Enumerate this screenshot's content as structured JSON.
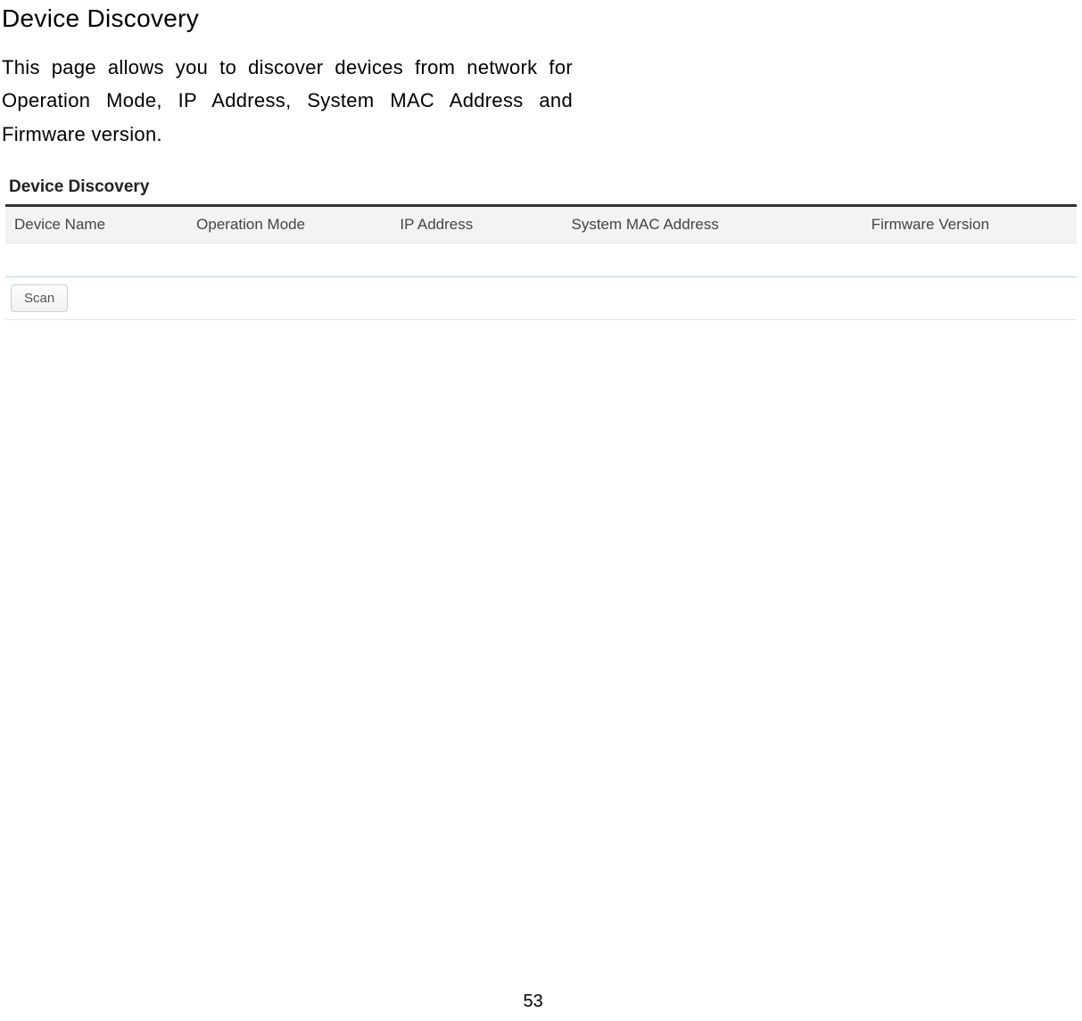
{
  "page": {
    "title": "Device Discovery",
    "description": "This page allows you to discover devices from network for Operation Mode, IP Address, System MAC Address and Firmware version.",
    "number": "53"
  },
  "panel": {
    "title": "Device Discovery",
    "columns": {
      "device_name": "Device Name",
      "operation_mode": "Operation Mode",
      "ip_address": "IP Address",
      "system_mac": "System MAC Address",
      "firmware": "Firmware Version"
    },
    "scan_label": "Scan"
  }
}
